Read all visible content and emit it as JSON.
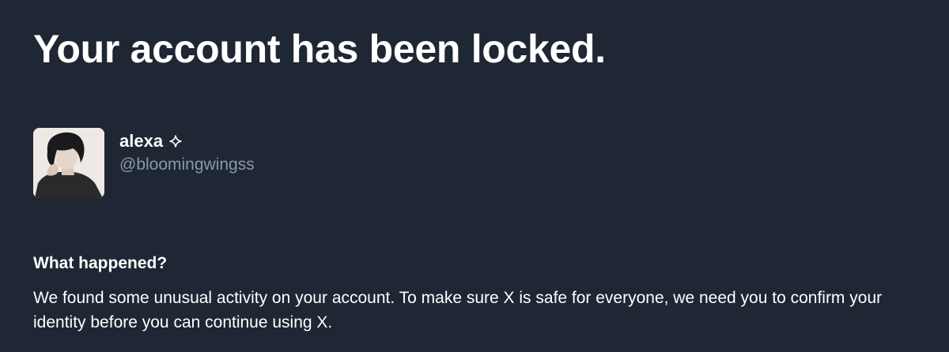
{
  "page": {
    "title": "Your account has been locked."
  },
  "account": {
    "display_name": "alexa",
    "badge_icon": "sparkle-icon",
    "handle": "@bloomingwingss",
    "avatar": "profile-photo"
  },
  "notice": {
    "heading": "What happened?",
    "body": "We found some unusual activity on your account. To make sure X is safe for everyone, we need you to confirm your identity before you can continue using X."
  },
  "colors": {
    "background": "#1e2733",
    "primary_text": "#ffffff",
    "secondary_text": "#8b98a5"
  }
}
